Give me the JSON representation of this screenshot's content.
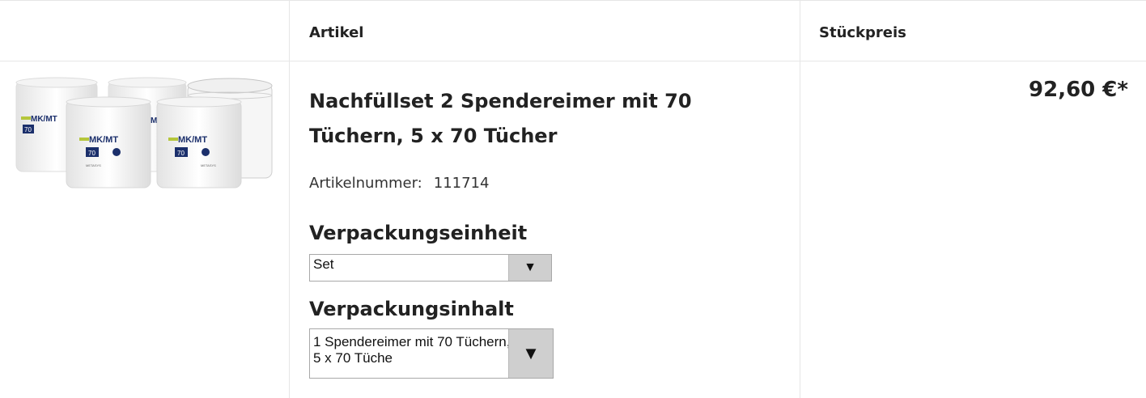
{
  "table": {
    "headers": {
      "article": "Artikel",
      "unit_price": "Stückpreis"
    }
  },
  "product": {
    "title": "Nachfüllset 2 Spendereimer mit 70 Tüchern, 5 x 70 Tücher",
    "article_number_label": "Artikelnummer:",
    "article_number": "111714",
    "image_text": {
      "brand": "MK/MT",
      "count": "70",
      "maker": "METASYS"
    },
    "price": "92,60 €*"
  },
  "options": {
    "packaging_unit": {
      "label": "Verpackungseinheit",
      "selected": "Set"
    },
    "packaging_content": {
      "label": "Verpackungsinhalt",
      "selected": "1 Spendereimer mit 70 Tüchern, 5 x 70 Tüche"
    }
  },
  "icons": {
    "dropdown": "chevron-down-icon"
  }
}
